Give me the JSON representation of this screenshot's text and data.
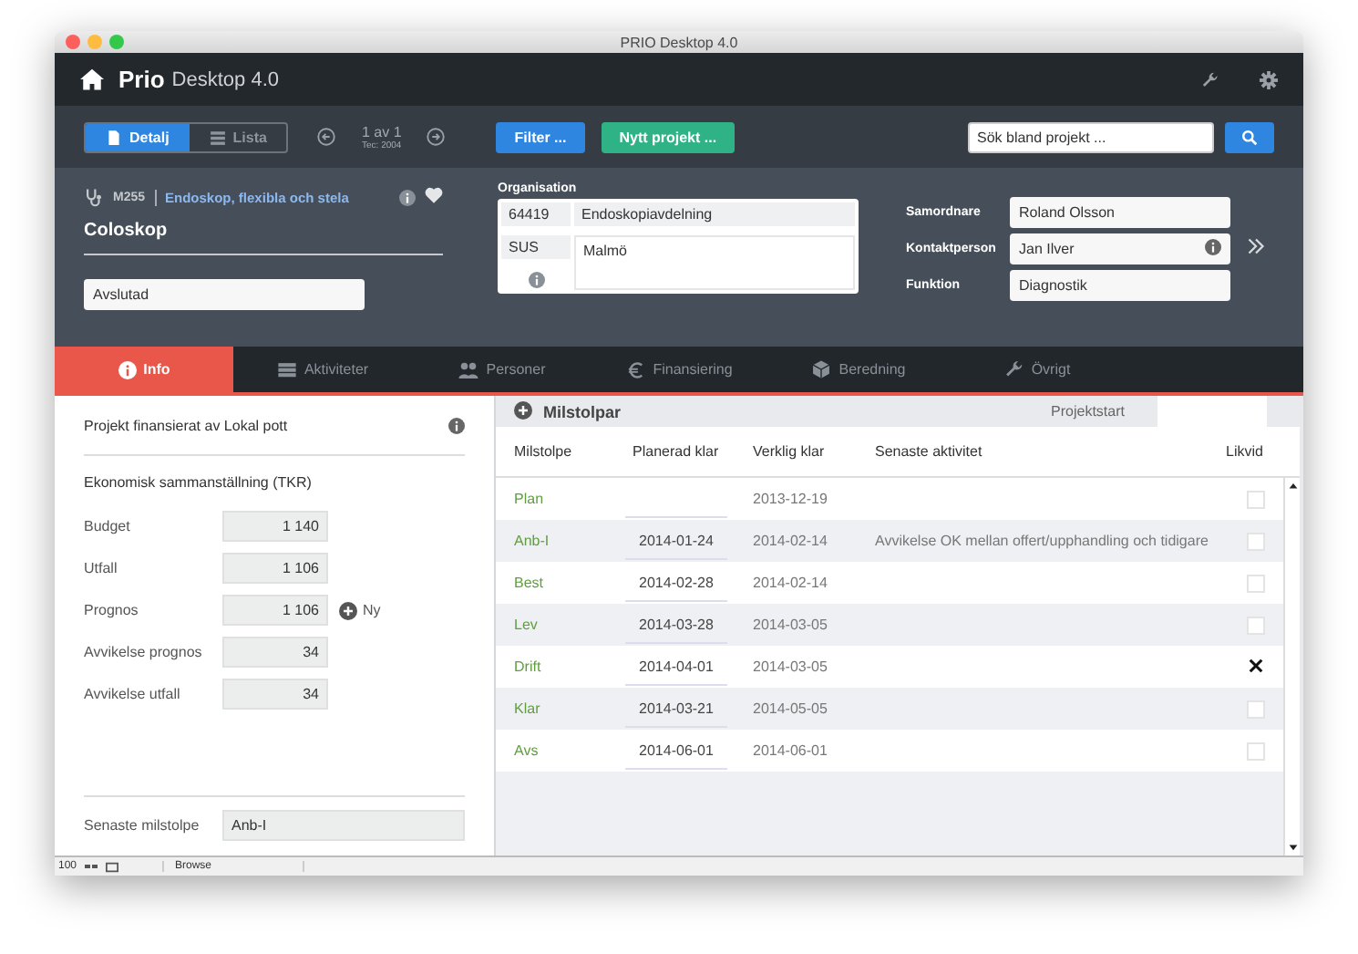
{
  "window": {
    "title": "PRIO Desktop 4.0"
  },
  "app": {
    "brand": "Prio",
    "product": "Desktop 4.0"
  },
  "toolbar": {
    "views": [
      {
        "label": "Detalj",
        "selected": true
      },
      {
        "label": "Lista",
        "selected": false
      }
    ],
    "record": {
      "position": "1 av 1",
      "subtitle": "Tec: 2004"
    },
    "filter_button": "Filter ...",
    "new_button": "Nytt projekt ...",
    "search": {
      "placeholder": "Sök bland projekt ..."
    }
  },
  "project": {
    "code": "M255",
    "category": "Endoskop, flexibla och stela",
    "favorite": true,
    "name": "Coloskop",
    "status": "Avslutad",
    "organisation": {
      "label": "Organisation",
      "rows": [
        {
          "code": "64419",
          "name": "Endoskopiavdelning"
        },
        {
          "code": "SUS",
          "name": "Malmö"
        }
      ]
    },
    "contacts": [
      {
        "label": "Samordnare",
        "value": "Roland Olsson",
        "info": false
      },
      {
        "label": "Kontaktperson",
        "value": "Jan Ilver",
        "info": true
      },
      {
        "label": "Funktion",
        "value": "Diagnostik",
        "info": false
      }
    ]
  },
  "tabs": [
    {
      "label": "Info",
      "selected": true
    },
    {
      "label": "Aktiviteter",
      "selected": false
    },
    {
      "label": "Personer",
      "selected": false
    },
    {
      "label": "Finansiering",
      "selected": false
    },
    {
      "label": "Beredning",
      "selected": false
    },
    {
      "label": "Övrigt",
      "selected": false
    }
  ],
  "info": {
    "funding": "Projekt finansierat av Lokal pott",
    "section": "Ekonomisk sammanställning (TKR)",
    "fields": [
      {
        "label": "Budget",
        "value": "1 140"
      },
      {
        "label": "Utfall",
        "value": "1 106"
      },
      {
        "label": "Prognos",
        "value": "1 106",
        "action": "Ny"
      },
      {
        "label": "Avvikelse prognos",
        "value": "34"
      },
      {
        "label": "Avvikelse utfall",
        "value": "34"
      }
    ],
    "latest": {
      "label": "Senaste milstolpe",
      "value": "Anb-I"
    }
  },
  "milestones": {
    "title": "Milstolpar",
    "start_label": "Projektstart",
    "columns": [
      "Milstolpe",
      "Planerad klar",
      "Verklig klar",
      "Senaste aktivitet",
      "Likvid"
    ],
    "rows": [
      {
        "name": "Plan",
        "planned": "",
        "actual": "2013-12-19",
        "activity": "",
        "paid": false
      },
      {
        "name": "Anb-I",
        "planned": "2014-01-24",
        "actual": "2014-02-14",
        "activity": "Avvikelse OK mellan offert/upphandling och tidigare",
        "paid": false
      },
      {
        "name": "Best",
        "planned": "2014-02-28",
        "actual": "2014-02-14",
        "activity": "",
        "paid": false
      },
      {
        "name": "Lev",
        "planned": "2014-03-28",
        "actual": "2014-03-05",
        "activity": "",
        "paid": false
      },
      {
        "name": "Drift",
        "planned": "2014-04-01",
        "actual": "2014-03-05",
        "activity": "",
        "paid": true
      },
      {
        "name": "Klar",
        "planned": "2014-03-21",
        "actual": "2014-05-05",
        "activity": "",
        "paid": false
      },
      {
        "name": "Avs",
        "planned": "2014-06-01",
        "actual": "2014-06-01",
        "activity": "",
        "paid": false
      }
    ]
  },
  "status_bar": {
    "zoom": "100",
    "mode": "Browse"
  }
}
